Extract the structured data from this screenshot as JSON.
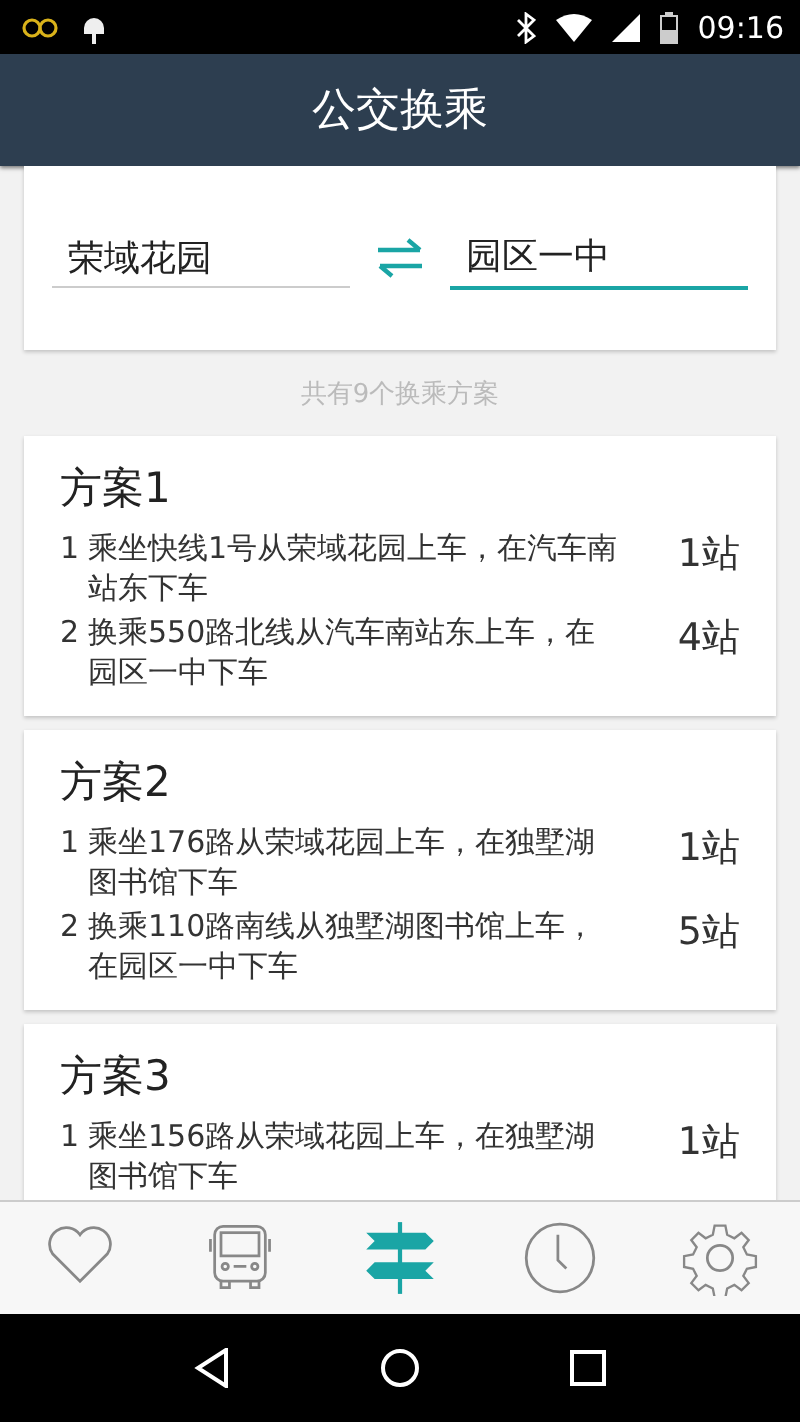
{
  "status_bar": {
    "time": "09:16"
  },
  "app_bar": {
    "title": "公交换乘"
  },
  "route": {
    "from": {
      "value": "荣域花园",
      "focused": false
    },
    "to": {
      "value": "园区一中",
      "focused": true
    }
  },
  "summary": "共有9个换乘方案",
  "plans": [
    {
      "title": "方案1",
      "steps": [
        {
          "number": "1",
          "text": "乘坐快线1号从荣域花园上车，在汽车南站东下车",
          "stops": "1站"
        },
        {
          "number": "2",
          "text": "换乘550路北线从汽车南站东上车，在园区一中下车",
          "stops": "4站"
        }
      ]
    },
    {
      "title": "方案2",
      "steps": [
        {
          "number": "1",
          "text": "乘坐176路从荣域花园上车，在独墅湖图书馆下车",
          "stops": "1站"
        },
        {
          "number": "2",
          "text": "换乘110路南线从独墅湖图书馆上车，在园区一中下车",
          "stops": "5站"
        }
      ]
    },
    {
      "title": "方案3",
      "steps": [
        {
          "number": "1",
          "text": "乘坐156路从荣域花园上车，在独墅湖图书馆下车",
          "stops": "1站"
        }
      ]
    }
  ],
  "tabs": [
    {
      "kind": "favorites",
      "selected": false
    },
    {
      "kind": "bus",
      "selected": false
    },
    {
      "kind": "transfer",
      "selected": true
    },
    {
      "kind": "history",
      "selected": false
    },
    {
      "kind": "settings",
      "selected": false
    }
  ]
}
